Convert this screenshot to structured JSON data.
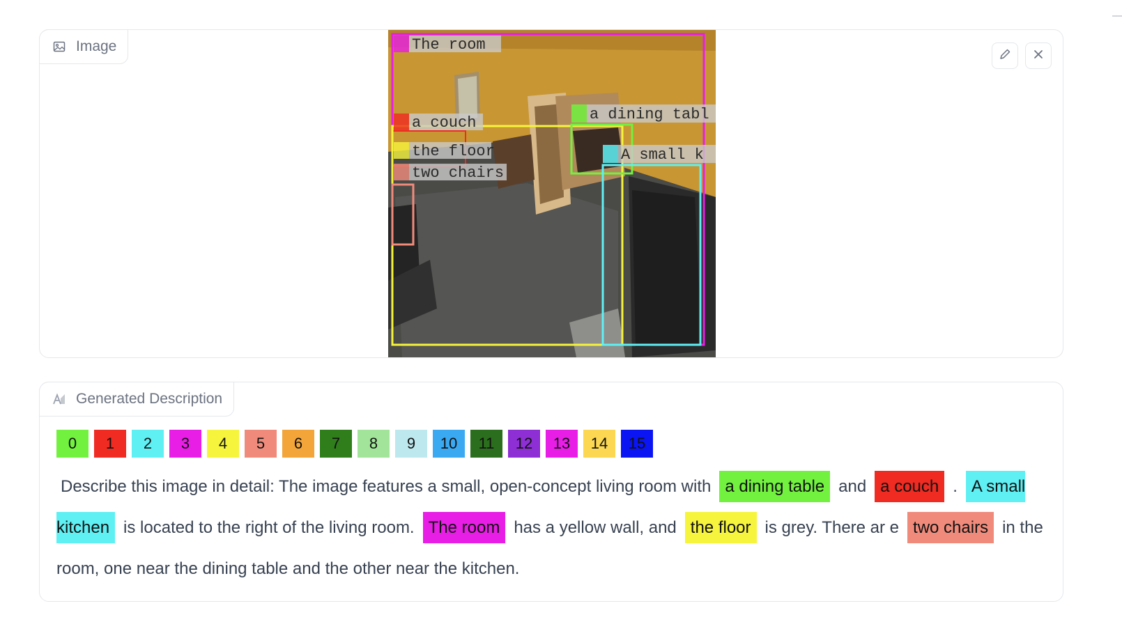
{
  "image_panel": {
    "label": "Image",
    "actions": [
      "pencil-icon",
      "close-icon"
    ]
  },
  "scene": {
    "box_labels": {
      "room": "The room",
      "couch": "a couch",
      "floor": "the floor",
      "chairs": "two chairs",
      "table": "a dining tabl",
      "kitchen": "A small k"
    },
    "colors": {
      "room": "#e91ee6",
      "couch": "#ef2b22",
      "floor": "#f6f43c",
      "chairs": "#f08b7c",
      "table": "#72f13f",
      "kitchen": "#5ff0f4"
    }
  },
  "desc_panel": {
    "label": "Generated Description",
    "legend": [
      {
        "label": "0",
        "color": "#72f13f"
      },
      {
        "label": "1",
        "color": "#ef2b22"
      },
      {
        "label": "2",
        "color": "#5ff0f4"
      },
      {
        "label": "3",
        "color": "#e91ee6"
      },
      {
        "label": "4",
        "color": "#f6f43c"
      },
      {
        "label": "5",
        "color": "#f08b7c"
      },
      {
        "label": "6",
        "color": "#f3a53a"
      },
      {
        "label": "7",
        "color": "#2f7d1b"
      },
      {
        "label": "8",
        "color": "#a2e59a"
      },
      {
        "label": "9",
        "color": "#bde8ee"
      },
      {
        "label": "10",
        "color": "#3aa9f2"
      },
      {
        "label": "11",
        "color": "#2b6e1d"
      },
      {
        "label": "12",
        "color": "#8e2fd6"
      },
      {
        "label": "13",
        "color": "#e91ee6"
      },
      {
        "label": "14",
        "color": "#fbd752"
      },
      {
        "label": "15",
        "color": "#0b14f2"
      }
    ],
    "segments": [
      {
        "text": "Describe this image in detail: The image features a small, open-concept living room with"
      },
      {
        "text": "a dining table",
        "color": "#72f13f"
      },
      {
        "text": "and"
      },
      {
        "text": "a couch",
        "color": "#ef2b22"
      },
      {
        "text": "."
      },
      {
        "text": "A small kitchen",
        "color": "#5ff0f4"
      },
      {
        "text": "is located to the right of the living room."
      },
      {
        "text": "The room",
        "color": "#e91ee6"
      },
      {
        "text": "has a yellow wall, and"
      },
      {
        "text": "the floor",
        "color": "#f6f43c"
      },
      {
        "text": "is grey. There ar e"
      },
      {
        "text": "two chairs",
        "color": "#f08b7c"
      },
      {
        "text": "in the room, one near the dining table and the other near the kitchen."
      }
    ]
  }
}
